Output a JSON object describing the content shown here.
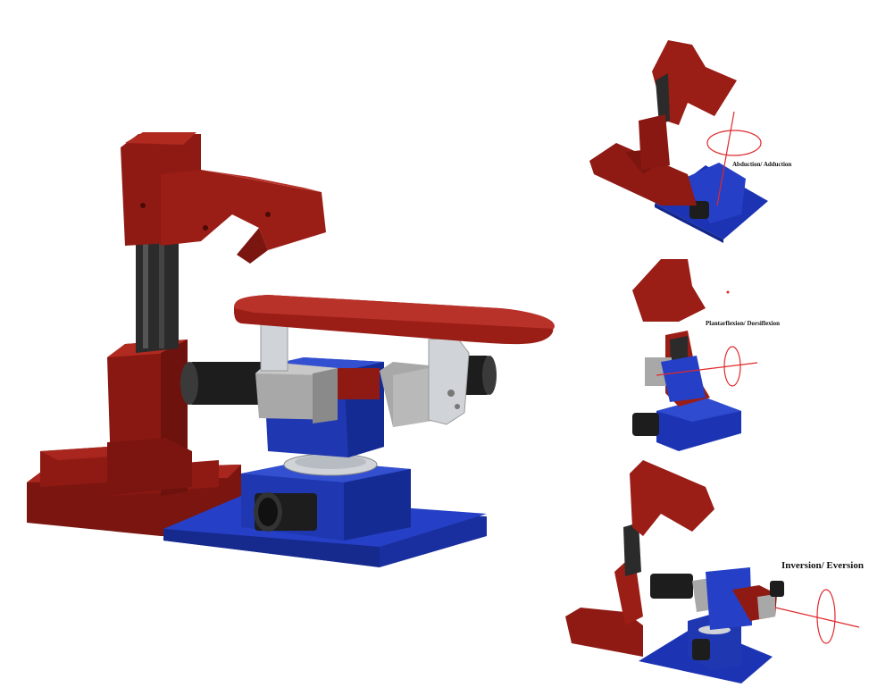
{
  "labels": {
    "abduction": "Abduction/ Adduction",
    "plantarflexion": "Plantarflexion/ Dorsiflexion",
    "inversion": "Inversion/ Eversion"
  },
  "colors": {
    "frame_red": "#8f1a14",
    "base_blue": "#1c34b4",
    "gray_block": "#a8a8a8",
    "motor_black": "#1d1d1d",
    "rail_dark": "#2b2b2b",
    "silver": "#d0d4d8",
    "axis_red": "#e0282c"
  }
}
